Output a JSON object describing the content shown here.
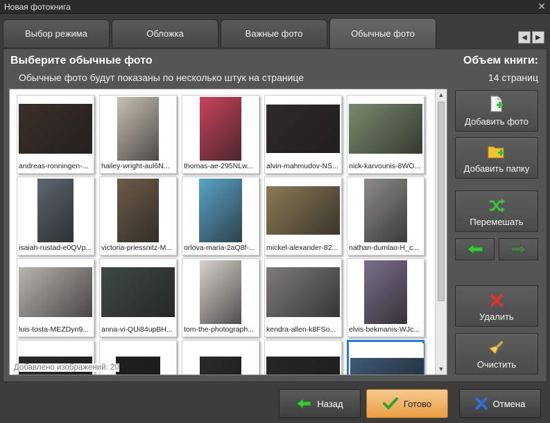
{
  "window": {
    "title": "Новая фотокнига"
  },
  "tabs": [
    {
      "label": "Выбор режима",
      "active": false
    },
    {
      "label": "Обложка",
      "active": false
    },
    {
      "label": "Важные фото",
      "active": false
    },
    {
      "label": "Обычные фото",
      "active": true
    }
  ],
  "header": {
    "title": "Выберите обычные фото",
    "subtitle": "Обычные фото будут показаны по несколько штук на странице",
    "volume_label": "Объем книги:",
    "volume_value": "14 страниц"
  },
  "photos": [
    {
      "name": "andreas-ronningen-...",
      "tone": "#3b2f28"
    },
    {
      "name": "hailey-wright-aul6N...",
      "tone": "#c9c0b3"
    },
    {
      "name": "thomas-ae-295NLw...",
      "tone": "#c9435a"
    },
    {
      "name": "alvin-mahmudov-NS...",
      "tone": "#2d2a28"
    },
    {
      "name": "nick-karvounis-8WO...",
      "tone": "#7a8a6e"
    },
    {
      "name": "isaiah-rustad-e0QVp...",
      "tone": "#5e6670"
    },
    {
      "name": "victoria-priessnitz-M...",
      "tone": "#6d5d4a"
    },
    {
      "name": "orlova-maria-2aQ8f-...",
      "tone": "#5aa3c8"
    },
    {
      "name": "mickel-alexander-82...",
      "tone": "#8b7a55"
    },
    {
      "name": "nathan-dumlao-H_c...",
      "tone": "#8d8c88"
    },
    {
      "name": "luis-tosta-MEZDyn9...",
      "tone": "#b9b4ae"
    },
    {
      "name": "anna-vi-QUi84upBH...",
      "tone": "#3f4a45"
    },
    {
      "name": "tom-the-photograph...",
      "tone": "#d7d2cc"
    },
    {
      "name": "kendra-allen-k8FSo...",
      "tone": "#7d7c78"
    },
    {
      "name": "elvis-bekmanis-WJc...",
      "tone": "#7b6f8a"
    },
    {
      "name": "",
      "tone": "#2a2a2a"
    },
    {
      "name": "",
      "tone": "#1f1f1f"
    },
    {
      "name": "",
      "tone": "#2a2a2a"
    },
    {
      "name": "",
      "tone": "#262626"
    },
    {
      "name": "",
      "tone": "#3d5a78"
    }
  ],
  "gallery": {
    "counter": "Добавлено изображений: 20"
  },
  "sidebar": {
    "add_photo": "Добавить фото",
    "add_folder": "Добавить папку",
    "shuffle": "Перемешать",
    "delete": "Удалить",
    "clear": "Очистить"
  },
  "footer": {
    "back": "Назад",
    "done": "Готово",
    "cancel": "Отмена"
  },
  "colors": {
    "accent": "#eb9e46",
    "selection": "#2a7ad6",
    "green": "#3cc43c",
    "red": "#e0322a",
    "blue": "#2f6fd6"
  }
}
